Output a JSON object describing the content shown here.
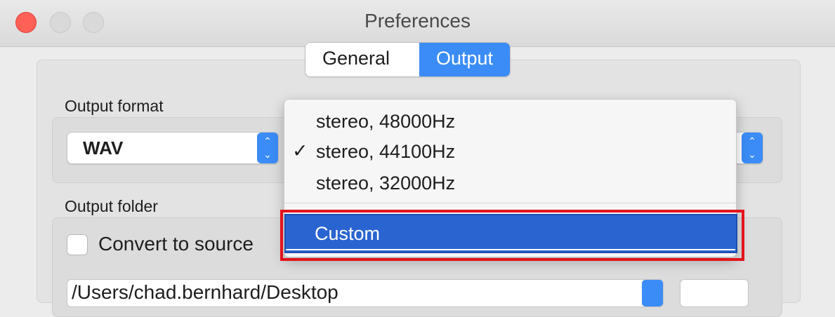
{
  "window": {
    "title": "Preferences"
  },
  "tabs": [
    {
      "label": "General",
      "selected": false
    },
    {
      "label": "Output",
      "selected": true
    }
  ],
  "output_format": {
    "label": "Output format",
    "selected_value": "WAV"
  },
  "format_menu": {
    "items": [
      {
        "label": "stereo, 48000Hz",
        "checked": false
      },
      {
        "label": "stereo, 44100Hz",
        "checked": true
      },
      {
        "label": "stereo, 32000Hz",
        "checked": false
      },
      {
        "label": "Custom",
        "highlighted": true
      }
    ],
    "checkmark": "✓"
  },
  "output_folder": {
    "label": "Output folder",
    "checkbox_label": "Convert to source",
    "checkbox_checked": false,
    "path": "/Users/chad.bernhard/Desktop"
  },
  "colors": {
    "accent": "#3b8cf6",
    "selection": "#2a64d1",
    "annotation": "#e3121b"
  }
}
